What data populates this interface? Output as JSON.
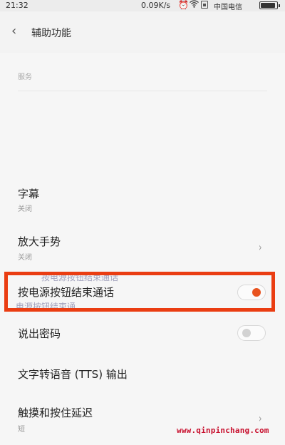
{
  "status_bar": {
    "time": "21:32",
    "speed": "0.09K/s",
    "carrier": "中国电信",
    "battery_level": 0.9,
    "icons": [
      "alarm-icon",
      "wifi-icon",
      "sim-icon",
      "battery-icon"
    ]
  },
  "header": {
    "back_icon": "chevron-left-icon",
    "title": "辅助功能"
  },
  "section": {
    "label": "服务"
  },
  "items": [
    {
      "title": "字幕",
      "subtitle": "关闭",
      "control": "none"
    },
    {
      "title": "放大手势",
      "subtitle": "关闭",
      "control": "chevron-right-icon"
    },
    {
      "title": "按电源按钮结束通话",
      "control": "toggle",
      "checked": true
    },
    {
      "title": "说出密码",
      "control": "toggle",
      "checked": false
    },
    {
      "title": "文字转语音 (TTS) 输出",
      "control": "none"
    },
    {
      "title": "触摸和按住延迟",
      "subtitle": "短",
      "control": "chevron-right-icon"
    }
  ],
  "ghost_text": {
    "line1": "按电源按钮结束通话",
    "line2": "电源按钮结束通"
  },
  "colors": {
    "accent": "#e8531f",
    "highlight_border": "#ea3d12",
    "watermark": "#c8102e",
    "background": "#f6f6f6"
  },
  "watermark": "www.qinpinchang.com"
}
